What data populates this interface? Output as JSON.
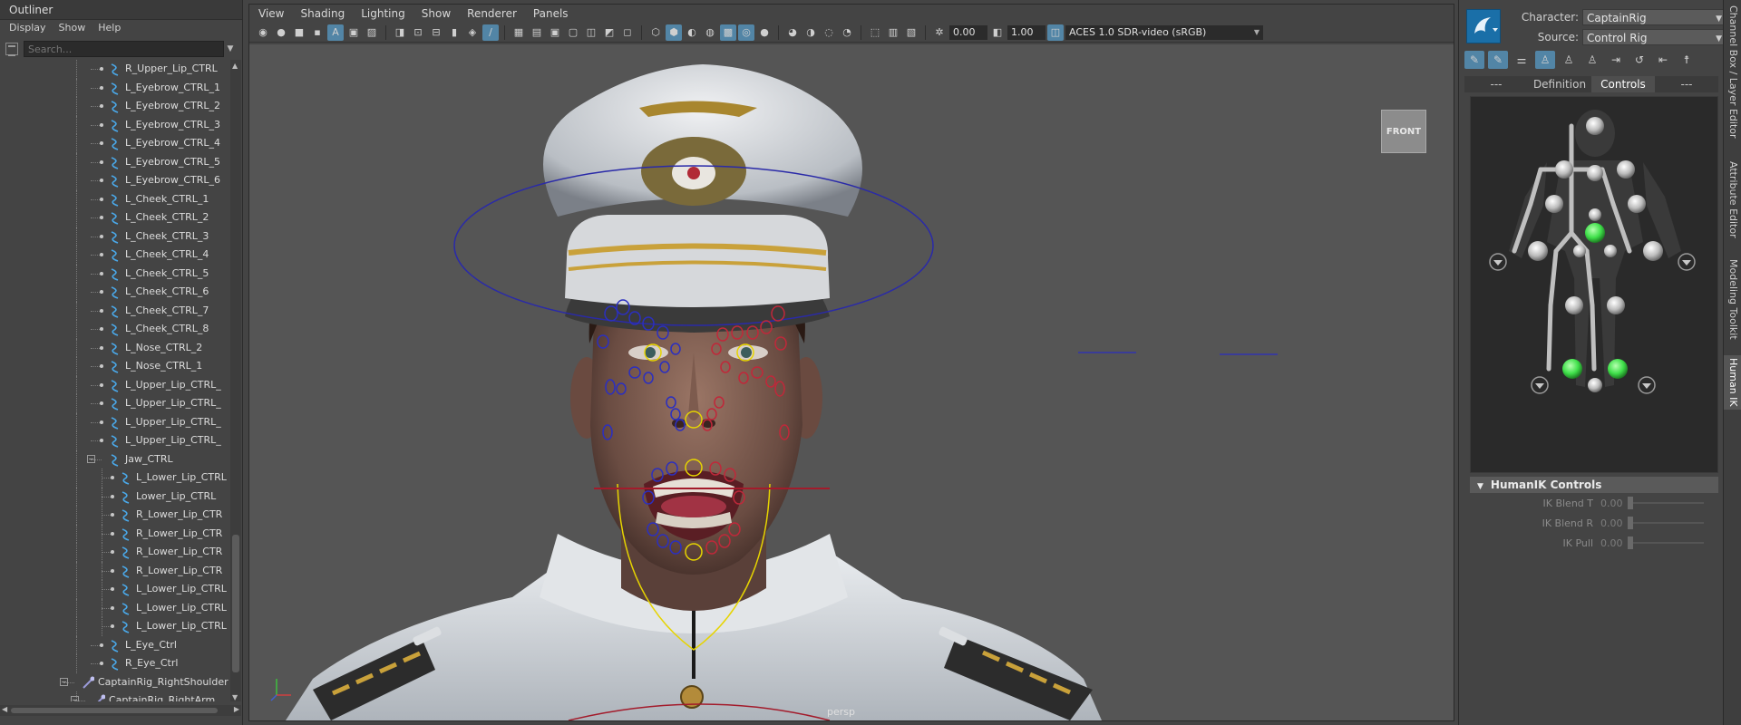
{
  "outliner": {
    "title": "Outliner",
    "menu": [
      "Display",
      "Show",
      "Help"
    ],
    "search_placeholder": "Search...",
    "rows": [
      {
        "label": "R_Upper_Lip_CTRL",
        "indent": 2,
        "type": "curve"
      },
      {
        "label": "L_Eyebrow_CTRL_1",
        "indent": 2,
        "type": "curve"
      },
      {
        "label": "L_Eyebrow_CTRL_2",
        "indent": 2,
        "type": "curve"
      },
      {
        "label": "L_Eyebrow_CTRL_3",
        "indent": 2,
        "type": "curve"
      },
      {
        "label": "L_Eyebrow_CTRL_4",
        "indent": 2,
        "type": "curve"
      },
      {
        "label": "L_Eyebrow_CTRL_5",
        "indent": 2,
        "type": "curve"
      },
      {
        "label": "L_Eyebrow_CTRL_6",
        "indent": 2,
        "type": "curve"
      },
      {
        "label": "L_Cheek_CTRL_1",
        "indent": 2,
        "type": "curve"
      },
      {
        "label": "L_Cheek_CTRL_2",
        "indent": 2,
        "type": "curve"
      },
      {
        "label": "L_Cheek_CTRL_3",
        "indent": 2,
        "type": "curve"
      },
      {
        "label": "L_Cheek_CTRL_4",
        "indent": 2,
        "type": "curve"
      },
      {
        "label": "L_Cheek_CTRL_5",
        "indent": 2,
        "type": "curve"
      },
      {
        "label": "L_Cheek_CTRL_6",
        "indent": 2,
        "type": "curve"
      },
      {
        "label": "L_Cheek_CTRL_7",
        "indent": 2,
        "type": "curve"
      },
      {
        "label": "L_Cheek_CTRL_8",
        "indent": 2,
        "type": "curve"
      },
      {
        "label": "L_Nose_CTRL_2",
        "indent": 2,
        "type": "curve"
      },
      {
        "label": "L_Nose_CTRL_1",
        "indent": 2,
        "type": "curve"
      },
      {
        "label": "L_Upper_Lip_CTRL_",
        "indent": 2,
        "type": "curve"
      },
      {
        "label": "L_Upper_Lip_CTRL_",
        "indent": 2,
        "type": "curve"
      },
      {
        "label": "L_Upper_Lip_CTRL_",
        "indent": 2,
        "type": "curve"
      },
      {
        "label": "L_Upper_Lip_CTRL_",
        "indent": 2,
        "type": "curve"
      },
      {
        "label": "Jaw_CTRL",
        "indent": 2,
        "type": "group"
      },
      {
        "label": "L_Lower_Lip_CTRL",
        "indent": 3,
        "type": "curve"
      },
      {
        "label": "Lower_Lip_CTRL",
        "indent": 3,
        "type": "curve"
      },
      {
        "label": "R_Lower_Lip_CTR",
        "indent": 3,
        "type": "curve"
      },
      {
        "label": "R_Lower_Lip_CTR",
        "indent": 3,
        "type": "curve"
      },
      {
        "label": "R_Lower_Lip_CTR",
        "indent": 3,
        "type": "curve"
      },
      {
        "label": "R_Lower_Lip_CTR",
        "indent": 3,
        "type": "curve"
      },
      {
        "label": "L_Lower_Lip_CTRL",
        "indent": 3,
        "type": "curve"
      },
      {
        "label": "L_Lower_Lip_CTRL",
        "indent": 3,
        "type": "curve"
      },
      {
        "label": "L_Lower_Lip_CTRL",
        "indent": 3,
        "type": "curve"
      },
      {
        "label": "L_Eye_Ctrl",
        "indent": 2,
        "type": "curve"
      },
      {
        "label": "R_Eye_Ctrl",
        "indent": 2,
        "type": "curve"
      },
      {
        "label": "CaptainRig_RightShoulder",
        "indent": 0,
        "type": "joint"
      },
      {
        "label": "CaptainRig_RightArm",
        "indent": 1,
        "type": "joint"
      }
    ]
  },
  "viewport": {
    "menu": [
      "View",
      "Shading",
      "Lighting",
      "Show",
      "Renderer",
      "Panels"
    ],
    "exposure": "0.00",
    "gamma": "1.00",
    "color_space": "ACES 1.0 SDR-video (sRGB)",
    "view_cube_label": "FRONT",
    "camera_label": "persp"
  },
  "humanik": {
    "character_label": "Character:",
    "character_value": "CaptainRig",
    "source_label": "Source:",
    "source_value": "Control Rig",
    "tabs": [
      "---",
      "Definition",
      "Controls",
      "---"
    ],
    "active_tab": "Controls",
    "section_title": "HumanIK Controls",
    "sliders": [
      {
        "label": "IK Blend T",
        "value": "0.00"
      },
      {
        "label": "IK Blend R",
        "value": "0.00"
      },
      {
        "label": "IK Pull",
        "value": "0.00"
      }
    ]
  },
  "side_tabs": [
    "Channel Box / Layer Editor",
    "Attribute Editor",
    "Modeling Toolkit",
    "Human IK"
  ],
  "colors": {
    "selection_blue": "#5285a6",
    "control_red": "#c0283a",
    "control_blue": "#2b2fc0",
    "control_yellow": "#e6d400",
    "effector_green": "#3fe04a"
  }
}
